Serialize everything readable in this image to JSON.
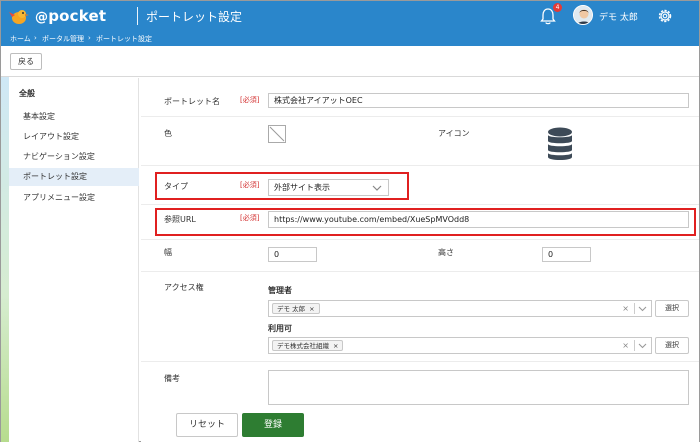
{
  "header": {
    "logo_text": "pocket",
    "logo_at": "@",
    "page_title": "ポートレット設定",
    "notification_count": "4",
    "user_name": "デモ 太郎"
  },
  "breadcrumb": {
    "home": "ホーム",
    "sep1": "›",
    "portal": "ポータル管理",
    "sep2": "›",
    "current": "ポートレット設定"
  },
  "toolbar": {
    "back_label": "戻る"
  },
  "sidebar": {
    "heading": "全般",
    "items": [
      {
        "label": "基本設定"
      },
      {
        "label": "レイアウト設定"
      },
      {
        "label": "ナビゲーション設定"
      },
      {
        "label": "ポートレット設定"
      },
      {
        "label": "アプリメニュー設定"
      }
    ]
  },
  "form": {
    "required_mark": "[必須]",
    "portlet_name_label": "ポートレット名",
    "portlet_name_value": "株式会社アイアットOEC",
    "color_label": "色",
    "icon_label": "アイコン",
    "type_label": "タイプ",
    "type_value": "外部サイト表示",
    "url_label": "参照URL",
    "url_value": "https://www.youtube.com/embed/XueSpMVOdd8",
    "width_label": "幅",
    "width_value": "0",
    "height_label": "高さ",
    "height_value": "0",
    "access_label": "アクセス権",
    "admin_label": "管理者",
    "admin_tag": "デモ 太郎",
    "user_label": "利用可",
    "user_tag": "デモ株式会社組織",
    "clear_glyph": "×",
    "tag_remove_glyph": "×",
    "select_button": "選択",
    "note_label": "備考",
    "reset_label": "リセット",
    "submit_label": "登録"
  },
  "colors": {
    "header_bg": "#2a86cb",
    "highlight_border": "#e02020",
    "submit_bg": "#2e7d32",
    "required": "#d32f2f"
  },
  "icons": [
    "bell-icon",
    "gear-icon",
    "database-icon",
    "chevron-down-icon",
    "logo-bird-icon"
  ]
}
